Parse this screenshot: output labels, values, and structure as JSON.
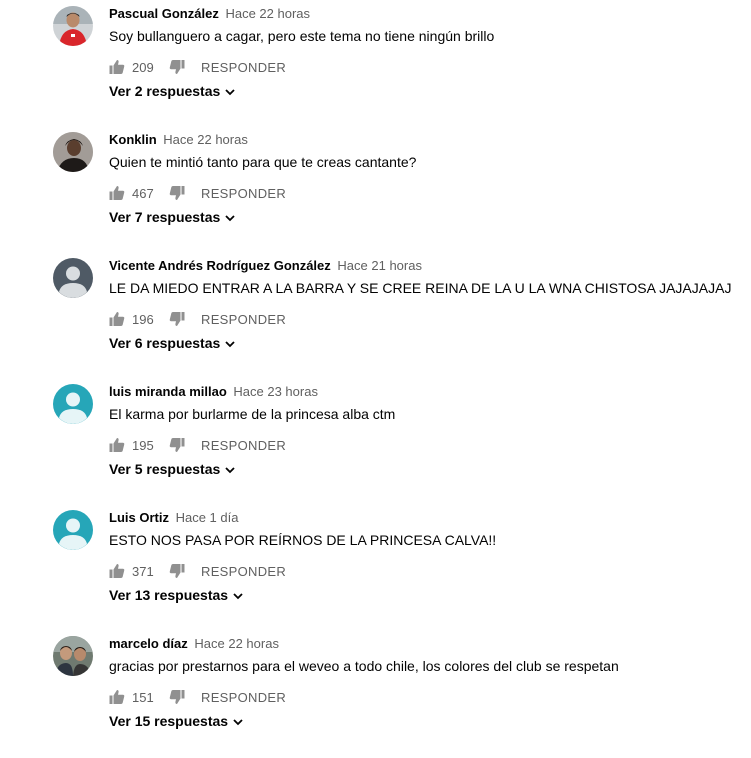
{
  "reply_label": "RESPONDER",
  "colors": {
    "author": "#030303",
    "meta": "#606060",
    "avatar_teal": "#26a6b8",
    "avatar_gray": "#4f5a65"
  },
  "comments": [
    {
      "author": "Pascual González",
      "time": "Hace 22 horas",
      "text": "Soy bullanguero a cagar, pero este tema no tiene ningún brillo",
      "likes": "209",
      "replies": "Ver 2 respuestas",
      "avatar": "photo-red-jersey"
    },
    {
      "author": "Konklin",
      "time": "Hace 22 horas",
      "text": "Quien te mintió tanto para que te creas cantante?",
      "likes": "467",
      "replies": "Ver 7 respuestas",
      "avatar": "photo-person"
    },
    {
      "author": "Vicente Andrés Rodríguez González",
      "time": "Hace 21 horas",
      "text": "LE DA MIEDO ENTRAR A LA BARRA Y SE CREE REINA DE LA U LA WNA CHISTOSA JAJAJAJAJ",
      "likes": "196",
      "replies": "Ver 6 respuestas",
      "avatar": "default-gray"
    },
    {
      "author": "luis miranda millao",
      "time": "Hace 23 horas",
      "text": "El karma por burlarme de la princesa alba ctm",
      "likes": "195",
      "replies": "Ver 5 respuestas",
      "avatar": "default-teal"
    },
    {
      "author": "Luis Ortiz",
      "time": "Hace 1 día",
      "text": "ESTO NOS PASA POR REÍRNOS DE LA PRINCESA CALVA!!",
      "likes": "371",
      "replies": "Ver 13 respuestas",
      "avatar": "default-teal"
    },
    {
      "author": "marcelo díaz",
      "time": "Hace 22 horas",
      "text": "gracias por prestarnos para el weveo a todo chile, los colores del club se respetan",
      "likes": "151",
      "replies": "Ver 15 respuestas",
      "avatar": "photo-two-people"
    }
  ]
}
